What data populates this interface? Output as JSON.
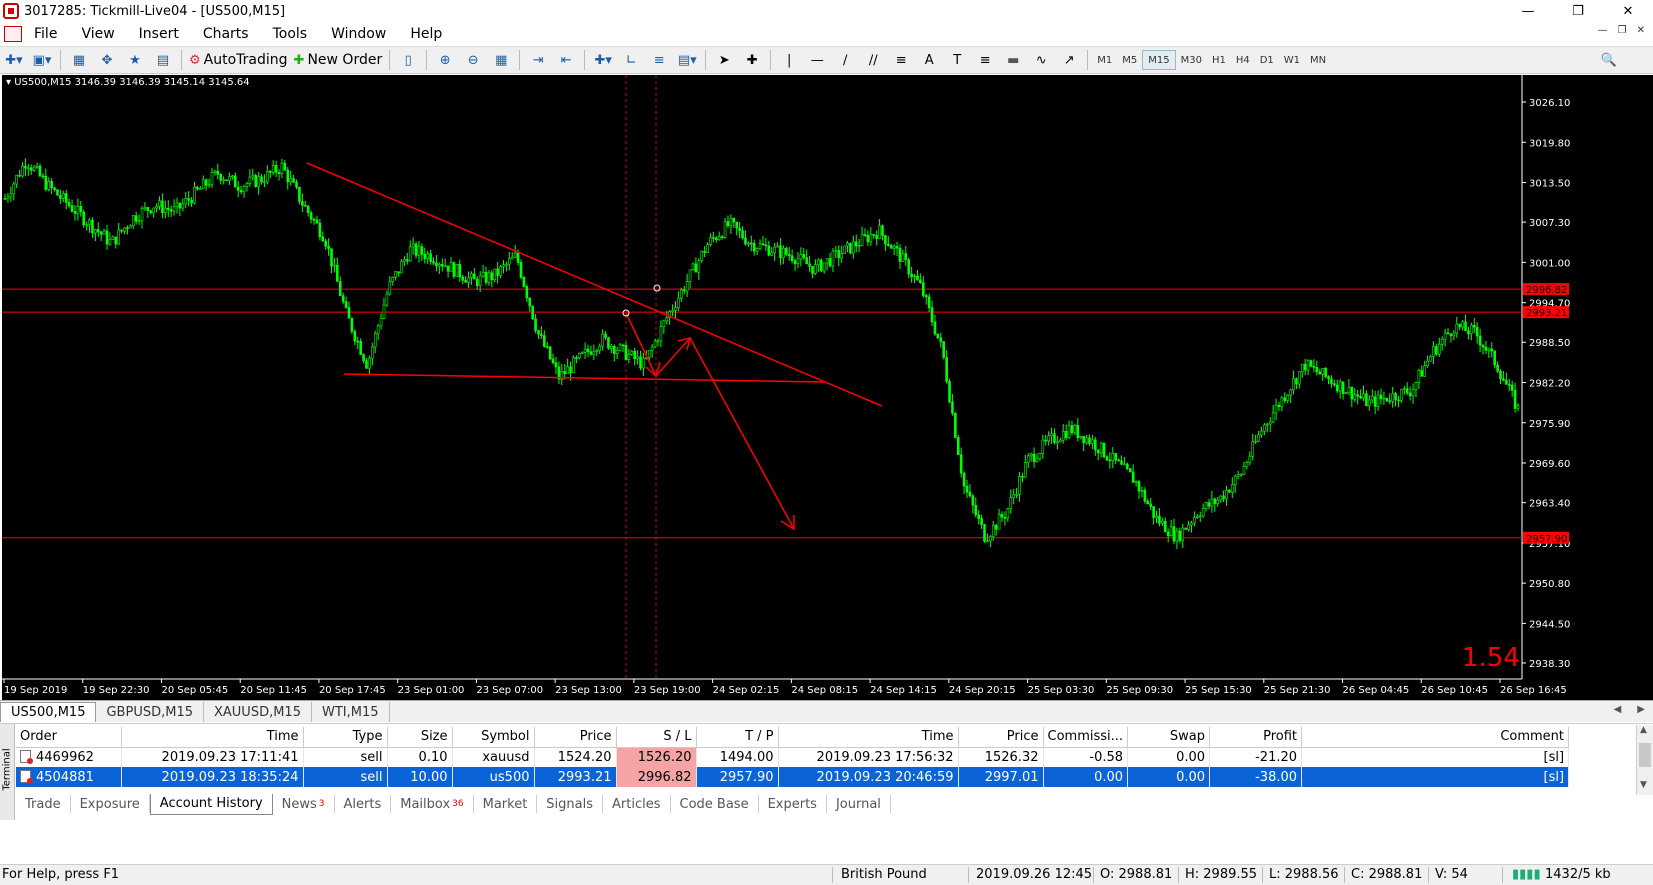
{
  "window": {
    "title": "3017285: Tickmill-Live04 - [US500,M15]"
  },
  "menu": [
    "File",
    "View",
    "Insert",
    "Charts",
    "Tools",
    "Window",
    "Help"
  ],
  "toolbar": {
    "autotrading_label": "AutoTrading",
    "new_order_label": "New Order",
    "timeframes": [
      "M1",
      "M5",
      "M15",
      "M30",
      "H1",
      "H4",
      "D1",
      "W1",
      "MN"
    ],
    "active_timeframe": "M15"
  },
  "chart": {
    "info": "US500,M15  3146.39 3146.39 3145.14 3145.64",
    "spread": "1.54",
    "price_labels": [
      "3026.10",
      "3019.80",
      "3013.50",
      "3007.30",
      "3001.00",
      "2994.70",
      "2988.50",
      "2982.20",
      "2975.90",
      "2969.60",
      "2963.40",
      "2957.10",
      "2950.80",
      "2944.50",
      "2938.30"
    ],
    "level_labels": [
      {
        "text": "2996.82",
        "price": 2996.82
      },
      {
        "text": "2993.21",
        "price": 2993.21
      },
      {
        "text": "2957.90",
        "price": 2957.9
      }
    ],
    "time_labels": [
      "19 Sep 2019",
      "19 Sep 22:30",
      "20 Sep 05:45",
      "20 Sep 11:45",
      "20 Sep 17:45",
      "23 Sep 01:00",
      "23 Sep 07:00",
      "23 Sep 13:00",
      "23 Sep 19:00",
      "24 Sep 02:15",
      "24 Sep 08:15",
      "24 Sep 14:15",
      "24 Sep 20:15",
      "25 Sep 03:30",
      "25 Sep 09:30",
      "25 Sep 15:30",
      "25 Sep 21:30",
      "26 Sep 04:45",
      "26 Sep 10:45",
      "26 Sep 16:45"
    ]
  },
  "chart_data": {
    "type": "candlestick",
    "symbol": "US500",
    "timeframe": "M15",
    "ylim": [
      2938.3,
      3026.1
    ],
    "x_start": "19 Sep 2019",
    "x_end": "26 Sep 16:45",
    "series": [
      {
        "name": "US500,M15",
        "close_path": [
          3011,
          3017,
          3013,
          3010,
          3007,
          3004,
          3008,
          3010,
          3009,
          3012,
          3015,
          3013,
          3014,
          3016,
          3010,
          3005,
          2993,
          2985,
          2997,
          3003,
          3002,
          3000,
          2998,
          2999,
          3002,
          2990,
          2983,
          2986,
          2989,
          2987,
          2985,
          2992,
          2998,
          3004,
          3007,
          3004,
          3003,
          3002,
          3000,
          3002,
          3004,
          3006,
          3002,
          2997,
          2987,
          2966,
          2958,
          2962,
          2970,
          2973,
          2975,
          2973,
          2970,
          2967,
          2961,
          2958,
          2962,
          2964,
          2968,
          2975,
          2980,
          2985,
          2983,
          2981,
          2979,
          2980,
          2981,
          2987,
          2991,
          2990,
          2985,
          2978
        ]
      }
    ]
  },
  "chart_tabs": [
    "US500,M15",
    "GBPUSD,M15",
    "XAUUSD,M15",
    "WTI,M15"
  ],
  "terminal": {
    "side_label": "Terminal",
    "columns": [
      "Order",
      "Time",
      "Type",
      "Size",
      "Symbol",
      "Price",
      "S / L",
      "T / P",
      "Time",
      "Price",
      "Commissi...",
      "Swap",
      "Profit",
      "Comment"
    ],
    "rows": [
      [
        "4469962",
        "2019.09.23 17:11:41",
        "sell",
        "0.10",
        "xauusd",
        "1524.20",
        "1526.20",
        "1494.00",
        "2019.09.23 17:56:32",
        "1526.32",
        "-0.58",
        "0.00",
        "-21.20",
        "[sl]"
      ],
      [
        "4504881",
        "2019.09.23 18:35:24",
        "sell",
        "10.00",
        "us500",
        "2993.21",
        "2996.82",
        "2957.90",
        "2019.09.23 20:46:59",
        "2997.01",
        "0.00",
        "0.00",
        "-38.00",
        "[sl]"
      ]
    ],
    "tabs": [
      {
        "label": "Trade"
      },
      {
        "label": "Exposure"
      },
      {
        "label": "Account History"
      },
      {
        "label": "News",
        "badge": "3"
      },
      {
        "label": "Alerts"
      },
      {
        "label": "Mailbox",
        "badge": "36"
      },
      {
        "label": "Market"
      },
      {
        "label": "Signals"
      },
      {
        "label": "Articles"
      },
      {
        "label": "Code Base"
      },
      {
        "label": "Experts"
      },
      {
        "label": "Journal"
      }
    ],
    "active_tab": "Account History"
  },
  "status": {
    "help": "For Help, press F1",
    "profile": "British Pound",
    "datetime": "2019.09.26 12:45",
    "open": "O: 2988.81",
    "high": "H: 2989.55",
    "low": "L: 2988.56",
    "close": "C: 2988.81",
    "volume": "V: 54",
    "traffic": "1432/5 kb"
  },
  "colors": {
    "background": "#000000",
    "bull": "#00ff00",
    "bear": "#00ff00",
    "drawing": "#ff0000",
    "axis_text": "#ffffff",
    "selected_row": "#0a64d8",
    "sl_cell": "#f4a4a4"
  }
}
